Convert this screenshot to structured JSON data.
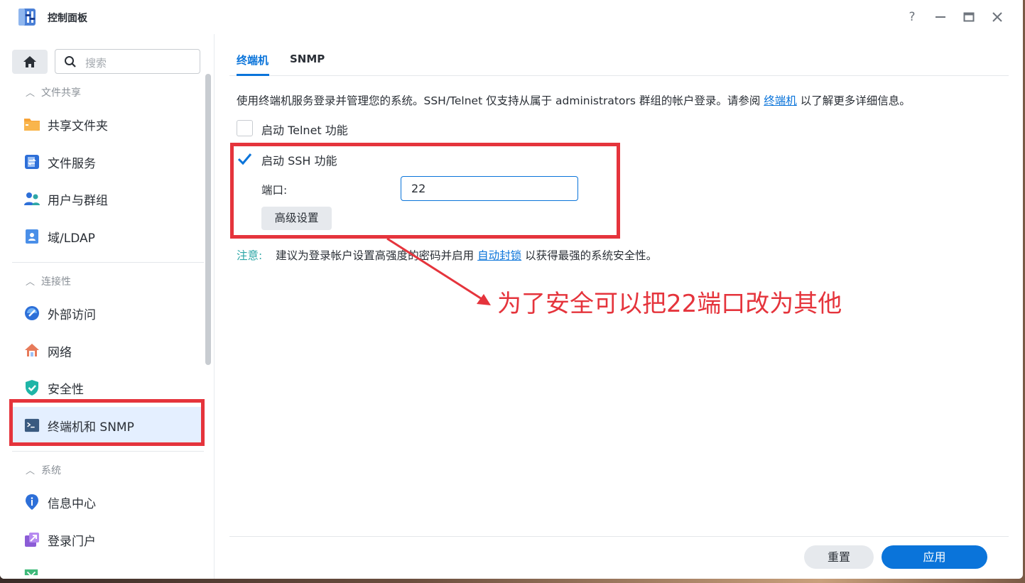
{
  "window": {
    "title": "控制面板",
    "help_glyph": "?",
    "min_glyph": "—",
    "max_glyph": "▭",
    "close_glyph": "✕"
  },
  "sidebar": {
    "search_placeholder": "搜索",
    "sections": [
      {
        "title": "文件共享",
        "items": [
          {
            "label": "共享文件夹",
            "icon": "shared-folder-icon"
          },
          {
            "label": "文件服务",
            "icon": "file-services-icon"
          },
          {
            "label": "用户与群组",
            "icon": "users-groups-icon"
          },
          {
            "label": "域/LDAP",
            "icon": "domain-ldap-icon"
          }
        ]
      },
      {
        "title": "连接性",
        "items": [
          {
            "label": "外部访问",
            "icon": "external-access-icon"
          },
          {
            "label": "网络",
            "icon": "network-icon"
          },
          {
            "label": "安全性",
            "icon": "security-shield-icon"
          },
          {
            "label": "终端机和 SNMP",
            "icon": "terminal-icon",
            "active": true
          }
        ]
      },
      {
        "title": "系统",
        "items": [
          {
            "label": "信息中心",
            "icon": "info-center-icon"
          },
          {
            "label": "登录门户",
            "icon": "login-portal-icon"
          }
        ]
      }
    ]
  },
  "tabs": [
    {
      "label": "终端机",
      "active": true
    },
    {
      "label": "SNMP",
      "active": false
    }
  ],
  "content": {
    "desc_before": "使用终端机服务登录并管理您的系统。SSH/Telnet 仅支持从属于 administrators 群组的帐户登录。请参阅",
    "desc_link": "终端机",
    "desc_after": "以了解更多详细信息。",
    "telnet": {
      "label": "启动 Telnet 功能",
      "checked": false
    },
    "ssh": {
      "label": "启动 SSH 功能",
      "checked": true
    },
    "port_label": "端口:",
    "port_value": "22",
    "advanced_button": "高级设置",
    "note_label": "注意:",
    "note_before": "建议为登录帐户设置高强度的密码并启用",
    "note_link": "自动封锁",
    "note_after": "以获得最强的系统安全性。"
  },
  "annotation": {
    "text": "为了安全可以把22端口改为其他",
    "color": "#e5343c"
  },
  "footer": {
    "reset_label": "重置",
    "apply_label": "应用"
  },
  "colors": {
    "accent": "#0a74da",
    "annotation_red": "#e5343c",
    "note_teal": "#2ea7a7"
  }
}
